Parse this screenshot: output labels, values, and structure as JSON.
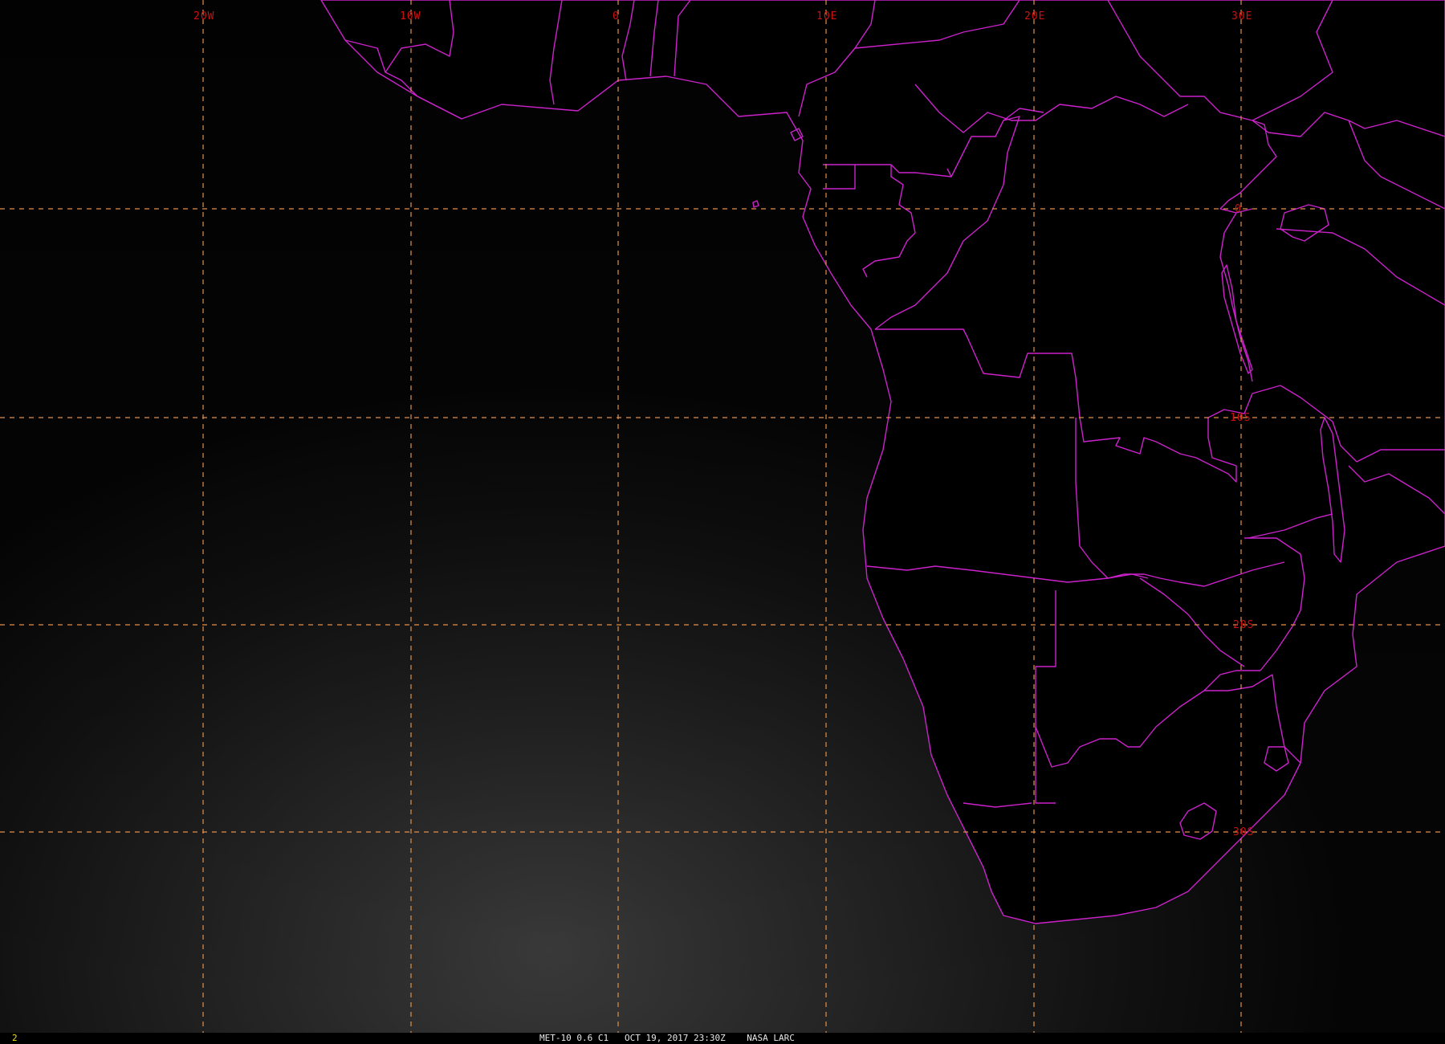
{
  "map": {
    "background_color": "#030303",
    "grid_color": "#e0904a",
    "label_color": "#d01010",
    "border_color": "#cc22cc",
    "longitude_labels": [
      "20W",
      "10W",
      "0",
      "10E",
      "20E",
      "30E"
    ],
    "latitude_labels": [
      "0",
      "10S",
      "20S",
      "30S"
    ]
  },
  "status_bar": {
    "frame_number": "2",
    "caption": "MET-10 0.6 C1   OCT 19, 2017 23:30Z    NASA LARC"
  }
}
